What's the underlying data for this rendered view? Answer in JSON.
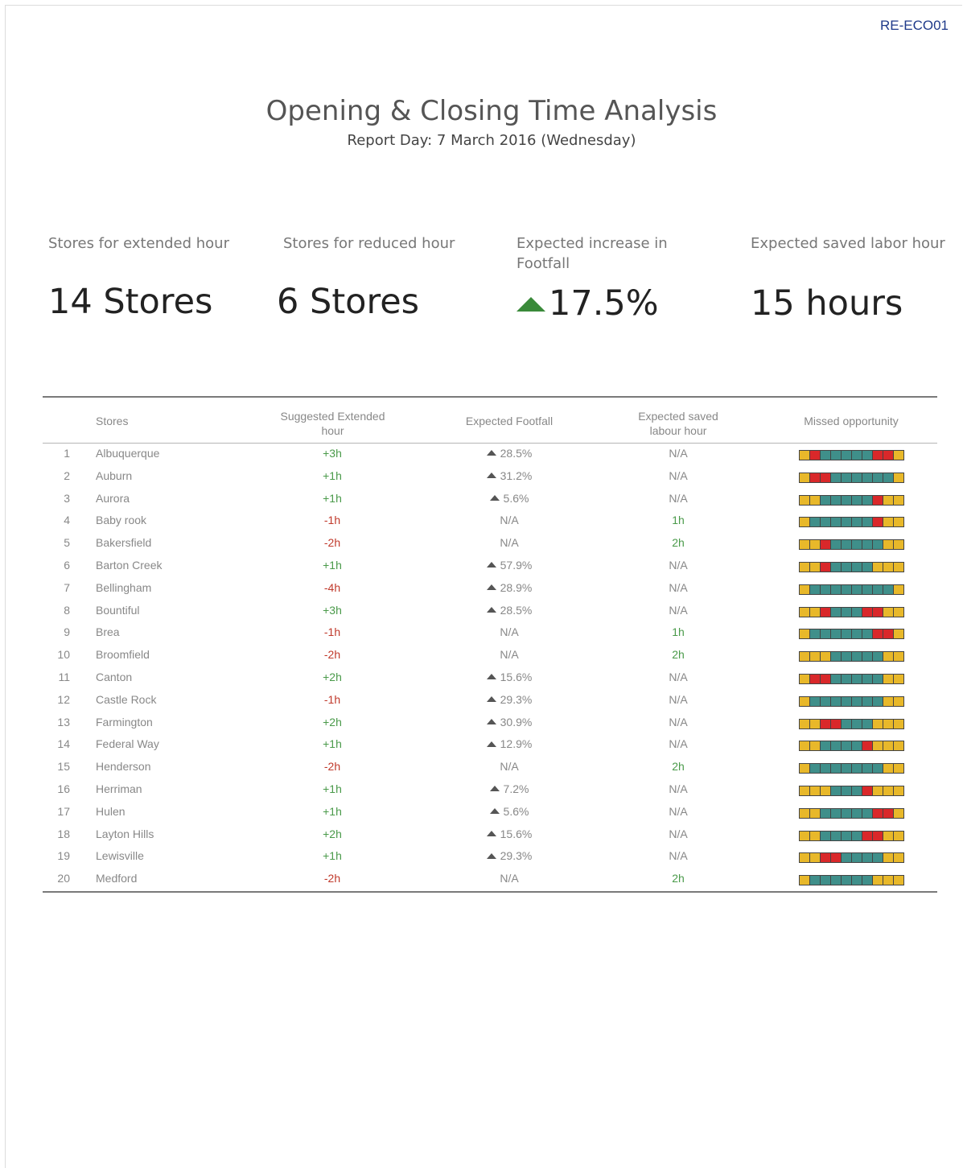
{
  "report_code": "RE-ECO01",
  "title": "Opening & Closing Time Analysis",
  "subtitle": "Report Day: 7 March 2016 (Wednesday)",
  "kpis": [
    {
      "label": "Stores for extended hour",
      "value": "14 Stores"
    },
    {
      "label": "Stores for reduced hour",
      "value": "6 Stores"
    },
    {
      "label": "Expected increase in Footfall",
      "value": "17.5%",
      "trend": "up"
    },
    {
      "label": "Expected saved labor hour",
      "value": "15 hours"
    }
  ],
  "table": {
    "headers": {
      "stores": "Stores",
      "extended": "Suggested Extended hour",
      "footfall": "Expected Footfall",
      "saved": "Expected saved labour hour",
      "missed": "Missed opportunity"
    },
    "legend_colors": {
      "Y": "#e8b82a",
      "T": "#3f8f8a",
      "R": "#d9282a"
    },
    "rows": [
      {
        "idx": "1",
        "store": "Albuquerque",
        "ext": "+3h",
        "foot": "28.5%",
        "save": "N/A",
        "missed": "YRTTTTTRRY"
      },
      {
        "idx": "2",
        "store": "Auburn",
        "ext": "+1h",
        "foot": "31.2%",
        "save": "N/A",
        "missed": "YRRTTTTTTY"
      },
      {
        "idx": "3",
        "store": "Aurora",
        "ext": "+1h",
        "foot": "5.6%",
        "save": "N/A",
        "missed": "YYTTTTTRYY"
      },
      {
        "idx": "4",
        "store": "Baby rook",
        "ext": "-1h",
        "foot": "N/A",
        "save": "1h",
        "missed": "YTTTTTTRYY"
      },
      {
        "idx": "5",
        "store": "Bakersfield",
        "ext": "-2h",
        "foot": "N/A",
        "save": "2h",
        "missed": "YYRTTTTTYY"
      },
      {
        "idx": "6",
        "store": "Barton Creek",
        "ext": "+1h",
        "foot": "57.9%",
        "save": "N/A",
        "missed": "YYRTTTTYYY"
      },
      {
        "idx": "7",
        "store": "Bellingham",
        "ext": "-4h",
        "foot": "28.9%",
        "save": "N/A",
        "missed": "YTTTTTTTTY"
      },
      {
        "idx": "8",
        "store": "Bountiful",
        "ext": "+3h",
        "foot": "28.5%",
        "save": "N/A",
        "missed": "YYRTTTRRYY"
      },
      {
        "idx": "9",
        "store": "Brea",
        "ext": "-1h",
        "foot": "N/A",
        "save": "1h",
        "missed": "YTTTTTTRRY"
      },
      {
        "idx": "10",
        "store": "Broomfield",
        "ext": "-2h",
        "foot": "N/A",
        "save": "2h",
        "missed": "YYYTTTTTYY"
      },
      {
        "idx": "11",
        "store": "Canton",
        "ext": "+2h",
        "foot": "15.6%",
        "save": "N/A",
        "missed": "YRRTTTTTYY"
      },
      {
        "idx": "12",
        "store": "Castle Rock",
        "ext": "-1h",
        "foot": "29.3%",
        "save": "N/A",
        "missed": "YTTTTTTTYY"
      },
      {
        "idx": "13",
        "store": "Farmington",
        "ext": "+2h",
        "foot": "30.9%",
        "save": "N/A",
        "missed": "YYRRTTTYYY"
      },
      {
        "idx": "14",
        "store": "Federal Way",
        "ext": "+1h",
        "foot": "12.9%",
        "save": "N/A",
        "missed": "YYTTTTRYYY"
      },
      {
        "idx": "15",
        "store": "Henderson",
        "ext": "-2h",
        "foot": "N/A",
        "save": "2h",
        "missed": "YTTTTTTTYY"
      },
      {
        "idx": "16",
        "store": "Herriman",
        "ext": "+1h",
        "foot": "7.2%",
        "save": "N/A",
        "missed": "YYYTTTRYYY"
      },
      {
        "idx": "17",
        "store": "Hulen",
        "ext": "+1h",
        "foot": "5.6%",
        "save": "N/A",
        "missed": "YYTTTTTRRY"
      },
      {
        "idx": "18",
        "store": "Layton Hills",
        "ext": "+2h",
        "foot": "15.6%",
        "save": "N/A",
        "missed": "YYTTTTRRYY"
      },
      {
        "idx": "19",
        "store": "Lewisville",
        "ext": "+1h",
        "foot": "29.3%",
        "save": "N/A",
        "missed": "YYRRTTTTYY"
      },
      {
        "idx": "20",
        "store": "Medford",
        "ext": "-2h",
        "foot": "N/A",
        "save": "2h",
        "missed": "YTTTTTTYYY"
      }
    ]
  }
}
